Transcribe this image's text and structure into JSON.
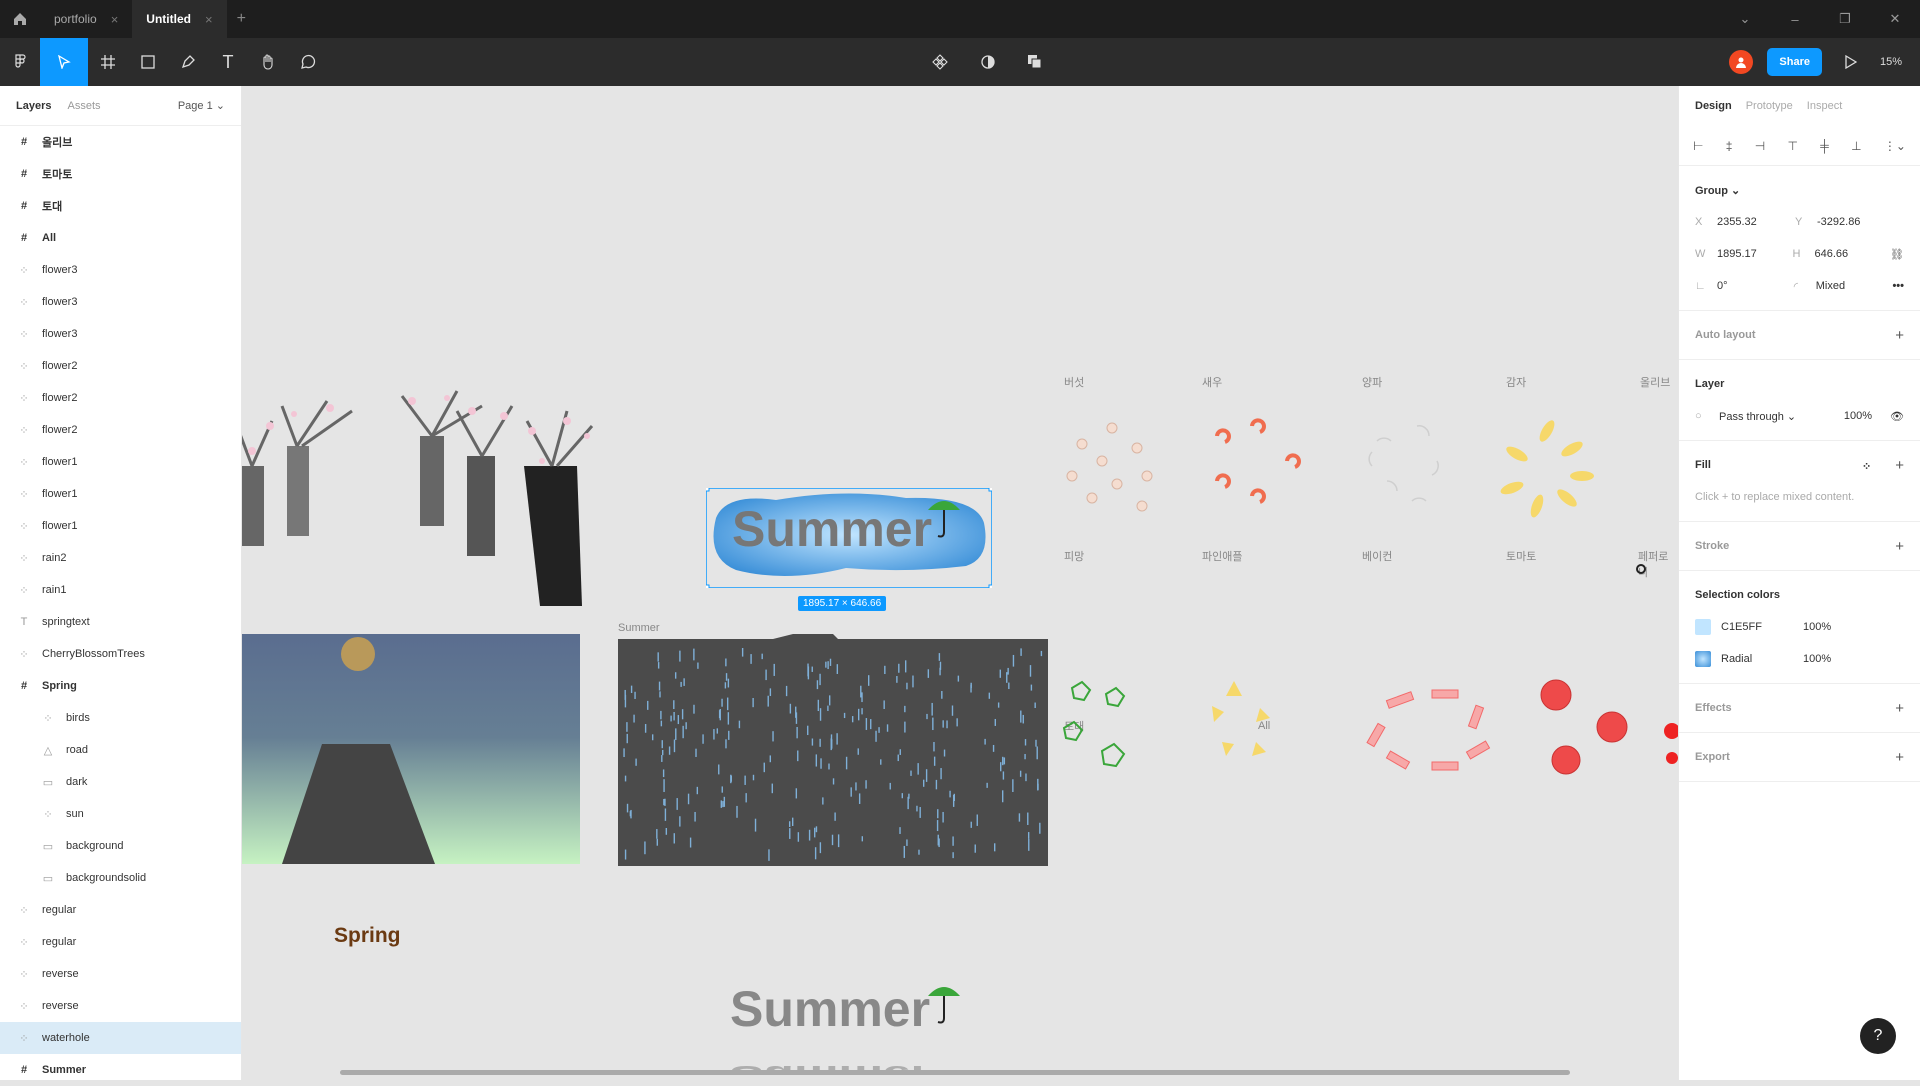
{
  "titlebar": {
    "tabs": [
      {
        "label": "portfolio",
        "active": false
      },
      {
        "label": "Untitled",
        "active": true
      }
    ]
  },
  "toolbar": {
    "share_label": "Share",
    "zoom": "15%"
  },
  "left_panel": {
    "tabs": {
      "layers": "Layers",
      "assets": "Assets",
      "page": "Page 1"
    },
    "layers": [
      {
        "name": "올리브",
        "type": "frame",
        "indent": 0
      },
      {
        "name": "토마토",
        "type": "frame",
        "indent": 0
      },
      {
        "name": "토대",
        "type": "frame",
        "indent": 0
      },
      {
        "name": "All",
        "type": "frame",
        "indent": 0
      },
      {
        "name": "flower3",
        "type": "group",
        "indent": 0
      },
      {
        "name": "flower3",
        "type": "group",
        "indent": 0
      },
      {
        "name": "flower3",
        "type": "group",
        "indent": 0
      },
      {
        "name": "flower2",
        "type": "group",
        "indent": 0
      },
      {
        "name": "flower2",
        "type": "group",
        "indent": 0
      },
      {
        "name": "flower2",
        "type": "group",
        "indent": 0
      },
      {
        "name": "flower1",
        "type": "group",
        "indent": 0
      },
      {
        "name": "flower1",
        "type": "group",
        "indent": 0
      },
      {
        "name": "flower1",
        "type": "group",
        "indent": 0
      },
      {
        "name": "rain2",
        "type": "group",
        "indent": 0
      },
      {
        "name": "rain1",
        "type": "group",
        "indent": 0
      },
      {
        "name": "springtext",
        "type": "text",
        "indent": 0
      },
      {
        "name": "CherryBlossomTrees",
        "type": "group",
        "indent": 0
      },
      {
        "name": "Spring",
        "type": "frame",
        "indent": 0
      },
      {
        "name": "birds",
        "type": "group",
        "indent": 1
      },
      {
        "name": "road",
        "type": "triangle",
        "indent": 1
      },
      {
        "name": "dark",
        "type": "rect",
        "indent": 1
      },
      {
        "name": "sun",
        "type": "group",
        "indent": 1
      },
      {
        "name": "background",
        "type": "rect",
        "indent": 1
      },
      {
        "name": "backgroundsolid",
        "type": "rect",
        "indent": 1
      },
      {
        "name": "regular",
        "type": "group",
        "indent": 0
      },
      {
        "name": "regular",
        "type": "group",
        "indent": 0
      },
      {
        "name": "reverse",
        "type": "group",
        "indent": 0
      },
      {
        "name": "reverse",
        "type": "group",
        "indent": 0
      },
      {
        "name": "waterhole",
        "type": "group",
        "indent": 0,
        "selected": true
      },
      {
        "name": "Summer",
        "type": "frame",
        "indent": 0
      }
    ]
  },
  "right_panel": {
    "tabs": {
      "design": "Design",
      "prototype": "Prototype",
      "inspect": "Inspect"
    },
    "group": {
      "title": "Group",
      "x": "2355.32",
      "y": "-3292.86",
      "w": "1895.17",
      "h": "646.66",
      "rotation": "0°",
      "radius": "Mixed"
    },
    "auto_layout": "Auto layout",
    "layer": {
      "title": "Layer",
      "blend": "Pass through",
      "opacity": "100%"
    },
    "fill": {
      "title": "Fill",
      "hint": "Click + to replace mixed content."
    },
    "stroke": "Stroke",
    "selection_colors": {
      "title": "Selection colors",
      "items": [
        {
          "name": "C1E5FF",
          "opacity": "100%",
          "color": "#C1E5FF"
        },
        {
          "name": "Radial",
          "opacity": "100%",
          "color": "#3a8fd8"
        }
      ]
    },
    "effects": "Effects",
    "export": "Export"
  },
  "canvas": {
    "labels": {
      "summer_frame": "Summer",
      "selection_size": "1895.17 × 646.66",
      "l1": "버섯",
      "l2": "새우",
      "l3": "양파",
      "l4": "감자",
      "l5": "올리브",
      "l6": "피망",
      "l7": "파인애플",
      "l8": "베이컨",
      "l9": "토마토",
      "l10": "페퍼로니",
      "l11": "토대",
      "l12": "All"
    },
    "text": {
      "summer_big": "Summer",
      "summer_small": "Summer",
      "spring": "Spring"
    }
  },
  "colors": {
    "accent": "#0d99ff",
    "toolbar": "#2c2c2c",
    "titlebar": "#1e1e1e",
    "canvas": "#e5e5e5"
  }
}
